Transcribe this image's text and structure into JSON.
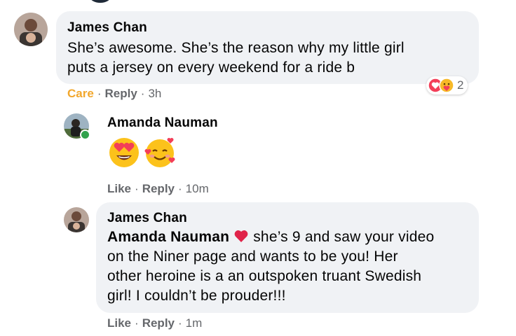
{
  "comments": [
    {
      "author": "James Chan",
      "text": "She’s awesome. She’s the reason why my little girl puts a jersey on every weekend for a ride b",
      "text_line1": "She’s awesome. She’s the reason why my little girl",
      "text_line2": "puts a jersey on every weekend for a ride b",
      "actions": {
        "react_label": "Care",
        "reply_label": "Reply",
        "time": "3h"
      },
      "reactions": {
        "icons": [
          "love-reaction-icon",
          "care-reaction-icon"
        ],
        "count": "2"
      },
      "replies": [
        {
          "author": "Amanda Nauman",
          "emojis": [
            "heart-eyes-emoji",
            "smiling-face-with-hearts-emoji"
          ],
          "online": true,
          "actions": {
            "react_label": "Like",
            "reply_label": "Reply",
            "time": "10m"
          }
        },
        {
          "author": "James Chan",
          "mention": "Amanda Nauman",
          "text": "she’s 9 and saw your video on the Niner page and wants to be you! Her other heroine is a an outspoken truant Swedish girl! I couldn’t be prouder!!!",
          "text_line1": "she’s 9 and saw your video",
          "text_line2": "on the Niner page and wants to be you! Her",
          "text_line3": "other heroine is a an outspoken truant Swedish",
          "text_line4": "girl! I couldn’t be prouder!!!",
          "inline_emoji": "red-heart-emoji",
          "actions": {
            "react_label": "Like",
            "reply_label": "Reply",
            "time": "1m"
          }
        }
      ]
    }
  ],
  "colors": {
    "bubble": "#f0f2f5",
    "meta": "#65676b",
    "care": "#f2a72c",
    "online": "#31a24c",
    "love": "#f33e58"
  }
}
